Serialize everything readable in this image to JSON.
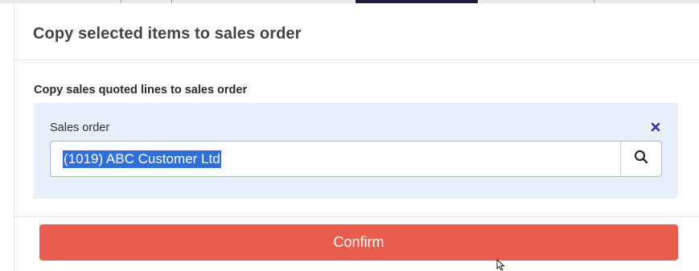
{
  "dialog": {
    "title": "Copy selected items to sales order",
    "section_title": "Copy sales quoted lines to sales order",
    "field": {
      "label": "Sales order",
      "value": "(1019) ABC Customer Ltd",
      "clear_icon": "close-icon",
      "search_icon": "search-icon"
    },
    "confirm_label": "Confirm"
  },
  "colors": {
    "confirm_bg": "#e85d4e",
    "panel_bg": "#e7f0fb",
    "selection_bg": "#2f6fd6",
    "clear_icon": "#3b2ea6"
  }
}
